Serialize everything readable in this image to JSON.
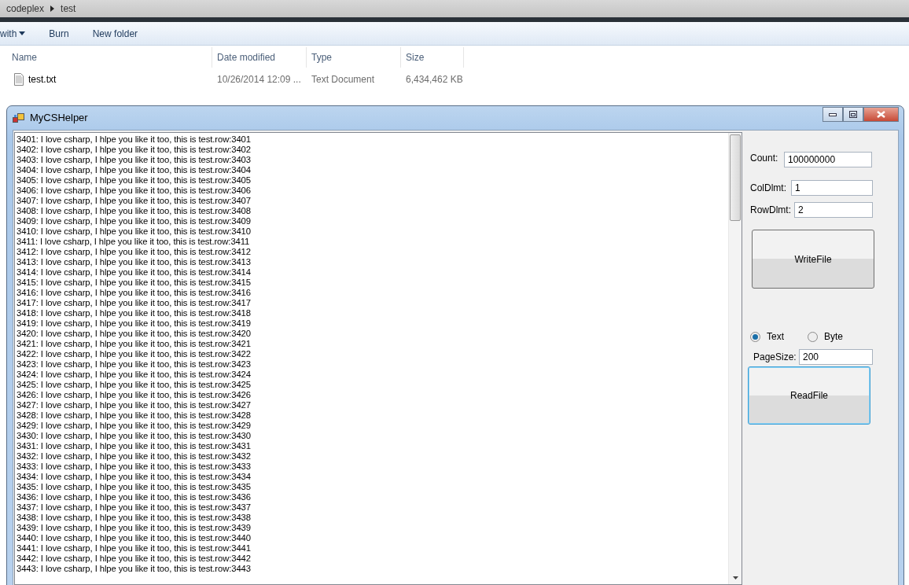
{
  "explorer": {
    "breadcrumb": [
      "codeplex",
      "test"
    ],
    "toolbar": [
      {
        "label": "with",
        "dropdown": true
      },
      {
        "label": "Burn",
        "dropdown": false
      },
      {
        "label": "New folder",
        "dropdown": false
      }
    ],
    "columns": [
      "Name",
      "Date modified",
      "Type",
      "Size"
    ],
    "files": [
      {
        "name": "test.txt",
        "date": "10/26/2014 12:09 ...",
        "type": "Text Document",
        "size": "6,434,462 KB"
      }
    ]
  },
  "window": {
    "title": "MyCSHelper",
    "lines": [
      "3401: I love csharp, I hlpe you like it too, this is test.row:3401",
      "3402: I love csharp, I hlpe you like it too, this is test.row:3402",
      "3403: I love csharp, I hlpe you like it too, this is test.row:3403",
      "3404: I love csharp, I hlpe you like it too, this is test.row:3404",
      "3405: I love csharp, I hlpe you like it too, this is test.row:3405",
      "3406: I love csharp, I hlpe you like it too, this is test.row:3406",
      "3407: I love csharp, I hlpe you like it too, this is test.row:3407",
      "3408: I love csharp, I hlpe you like it too, this is test.row:3408",
      "3409: I love csharp, I hlpe you like it too, this is test.row:3409",
      "3410: I love csharp, I hlpe you like it too, this is test.row:3410",
      "3411: I love csharp, I hlpe you like it too, this is test.row:3411",
      "3412: I love csharp, I hlpe you like it too, this is test.row:3412",
      "3413: I love csharp, I hlpe you like it too, this is test.row:3413",
      "3414: I love csharp, I hlpe you like it too, this is test.row:3414",
      "3415: I love csharp, I hlpe you like it too, this is test.row:3415",
      "3416: I love csharp, I hlpe you like it too, this is test.row:3416",
      "3417: I love csharp, I hlpe you like it too, this is test.row:3417",
      "3418: I love csharp, I hlpe you like it too, this is test.row:3418",
      "3419: I love csharp, I hlpe you like it too, this is test.row:3419",
      "3420: I love csharp, I hlpe you like it too, this is test.row:3420",
      "3421: I love csharp, I hlpe you like it too, this is test.row:3421",
      "3422: I love csharp, I hlpe you like it too, this is test.row:3422",
      "3423: I love csharp, I hlpe you like it too, this is test.row:3423",
      "3424: I love csharp, I hlpe you like it too, this is test.row:3424",
      "3425: I love csharp, I hlpe you like it too, this is test.row:3425",
      "3426: I love csharp, I hlpe you like it too, this is test.row:3426",
      "3427: I love csharp, I hlpe you like it too, this is test.row:3427",
      "3428: I love csharp, I hlpe you like it too, this is test.row:3428",
      "3429: I love csharp, I hlpe you like it too, this is test.row:3429",
      "3430: I love csharp, I hlpe you like it too, this is test.row:3430",
      "3431: I love csharp, I hlpe you like it too, this is test.row:3431",
      "3432: I love csharp, I hlpe you like it too, this is test.row:3432",
      "3433: I love csharp, I hlpe you like it too, this is test.row:3433",
      "3434: I love csharp, I hlpe you like it too, this is test.row:3434",
      "3435: I love csharp, I hlpe you like it too, this is test.row:3435",
      "3436: I love csharp, I hlpe you like it too, this is test.row:3436",
      "3437: I love csharp, I hlpe you like it too, this is test.row:3437",
      "3438: I love csharp, I hlpe you like it too, this is test.row:3438",
      "3439: I love csharp, I hlpe you like it too, this is test.row:3439",
      "3440: I love csharp, I hlpe you like it too, this is test.row:3440",
      "3441: I love csharp, I hlpe you like it too, this is test.row:3441",
      "3442: I love csharp, I hlpe you like it too, this is test.row:3442",
      "3443: I love csharp, I hlpe you like it too, this is test.row:3443"
    ],
    "fields": [
      {
        "label": "Count:",
        "value": "100000000"
      },
      {
        "label": "ColDlmt:",
        "value": "1"
      },
      {
        "label": "RowDlmt:",
        "value": "2"
      }
    ],
    "write_button": "WriteFile",
    "modes": [
      {
        "label": "Text",
        "selected": true
      },
      {
        "label": "Byte",
        "selected": false
      }
    ],
    "page_size": {
      "label": "PageSize:",
      "value": "200"
    },
    "read_button": {
      "label": "ReadFile",
      "focused": true
    }
  }
}
